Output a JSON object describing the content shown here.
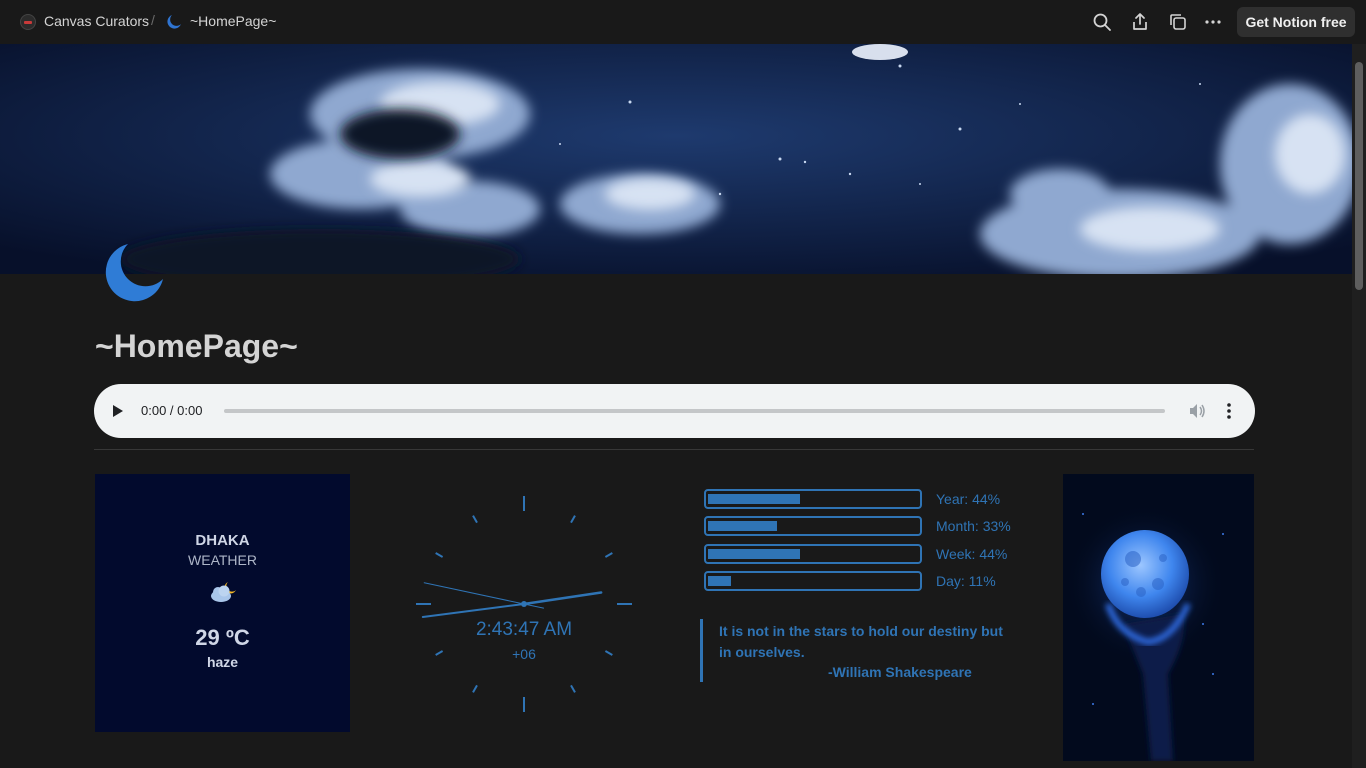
{
  "topbar": {
    "workspace": "Canvas Curators",
    "separator": "/",
    "page": "~HomePage~",
    "cta": "Get Notion free"
  },
  "page": {
    "title": "~HomePage~"
  },
  "audio": {
    "time": "0:00 / 0:00"
  },
  "weather": {
    "city": "DHAKA",
    "label": "WEATHER",
    "temp": "29 ºC",
    "description": "haze",
    "icon": "partly-cloudy-night-icon"
  },
  "clock": {
    "time": "2:43:47 AM",
    "timezone": "+06",
    "hour": 2,
    "minute": 43,
    "second": 47
  },
  "progress": [
    {
      "label": "Year: 44%",
      "percent": 44
    },
    {
      "label": "Month: 33%",
      "percent": 33
    },
    {
      "label": "Week: 44%",
      "percent": 44
    },
    {
      "label": "Day: 11%",
      "percent": 11
    }
  ],
  "quote": {
    "text": "It is not in the stars to hold our destiny but in ourselves.",
    "author": "-William Shakespeare"
  },
  "colors": {
    "accent": "#2f74b5",
    "background": "#191919",
    "weather_bg": "#020a2d"
  }
}
